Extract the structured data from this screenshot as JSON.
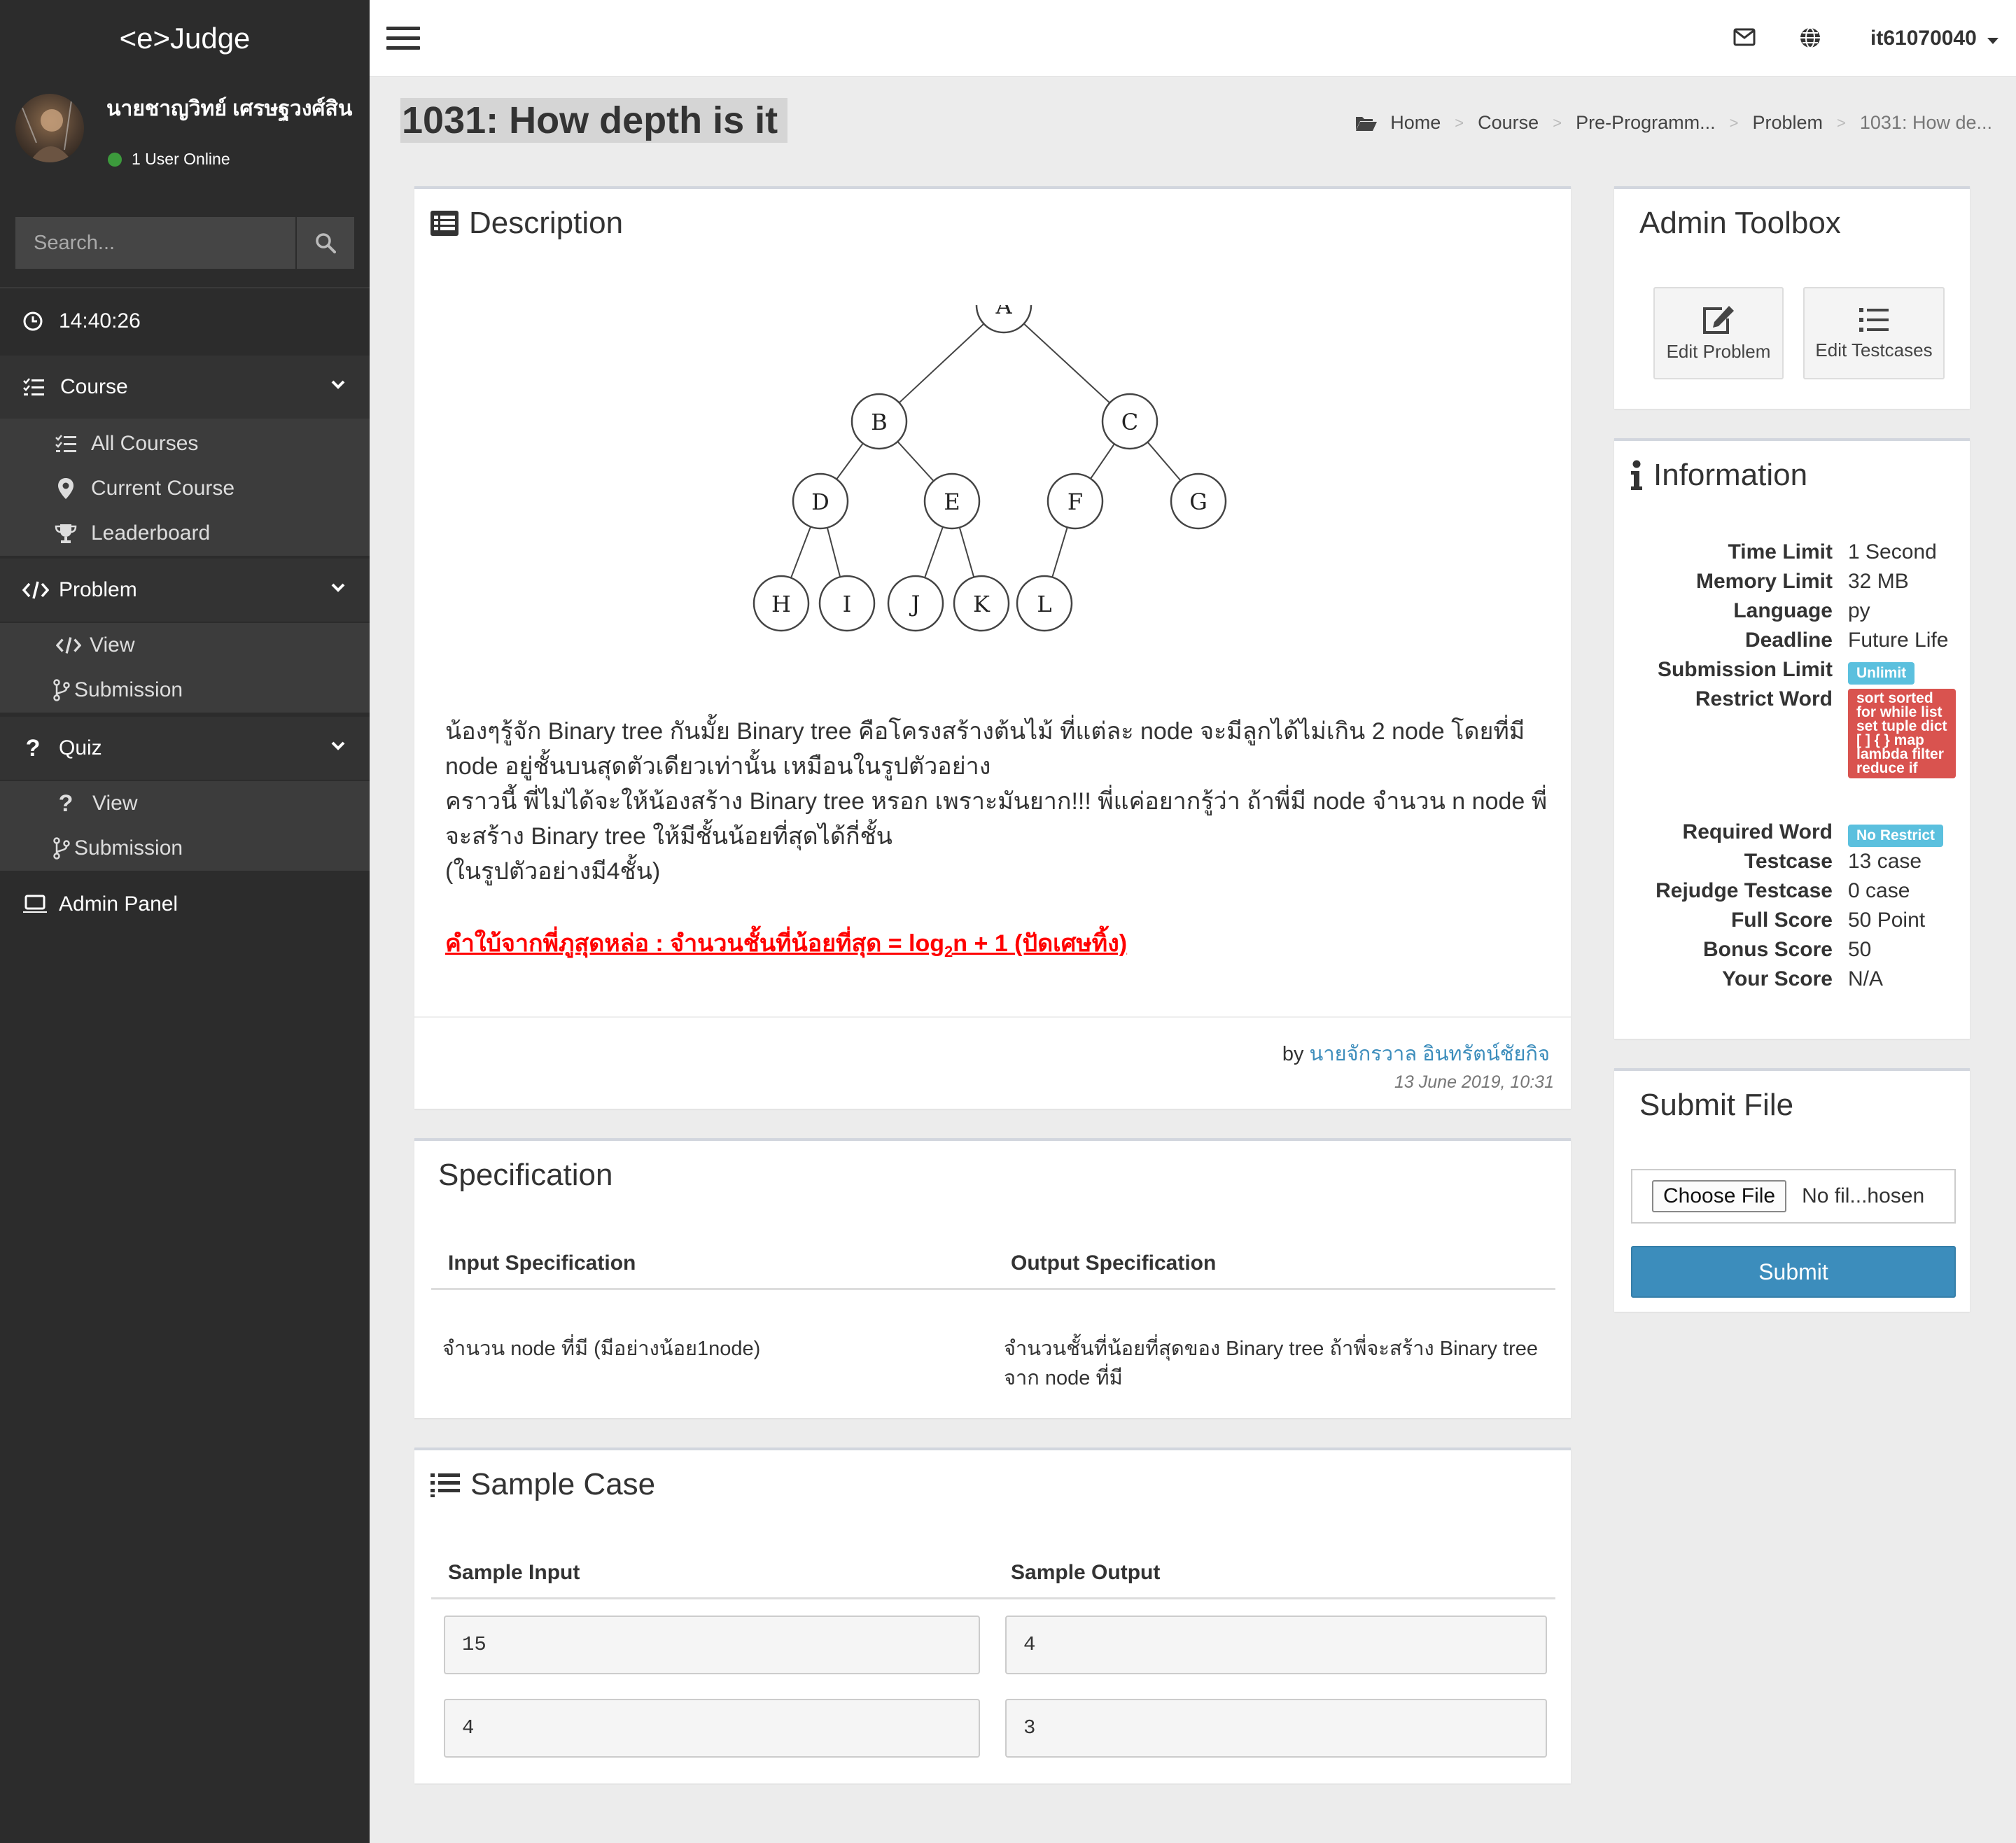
{
  "app": {
    "logo": "<e>Judge"
  },
  "user_panel": {
    "name": "นายชาญวิทย์ เศรษฐวงศ์สิน",
    "status": "1 User Online",
    "status_color": "#3c9a3c"
  },
  "sidebar": {
    "search_placeholder": "Search...",
    "clock": "14:40:26",
    "course": {
      "label": "Course",
      "items": [
        {
          "label": "All Courses",
          "icon": "list-check-icon"
        },
        {
          "label": "Current Course",
          "icon": "map-pin-icon"
        },
        {
          "label": "Leaderboard",
          "icon": "trophy-icon"
        }
      ]
    },
    "problem": {
      "label": "Problem",
      "items": [
        {
          "label": "View",
          "icon": "code-icon"
        },
        {
          "label": "Submission",
          "icon": "branch-icon"
        }
      ]
    },
    "quiz": {
      "label": "Quiz",
      "items": [
        {
          "label": "View",
          "icon": "question-icon"
        },
        {
          "label": "Submission",
          "icon": "branch-icon"
        }
      ]
    },
    "admin_panel": "Admin Panel"
  },
  "topbar": {
    "username": "it61070040"
  },
  "page": {
    "title": "1031: How depth is it"
  },
  "breadcrumb": [
    "Home",
    "Course",
    "Pre-Programm...",
    "Problem",
    "1031: How de..."
  ],
  "description": {
    "heading": "Description",
    "tree_nodes": [
      "A",
      "B",
      "C",
      "D",
      "E",
      "F",
      "G",
      "H",
      "I",
      "J",
      "K",
      "L"
    ],
    "paragraph_1": "น้องๆรู้จัก Binary tree กันมั้ย Binary tree คือโครงสร้างต้นไม้ ที่แต่ละ node จะมีลูกได้ไม่เกิน 2 node โดยที่มี node อยู่ชั้นบนสุดตัวเดียวเท่านั้น เหมือนในรูปตัวอย่าง",
    "paragraph_2": "คราวนี้ พี่ไม่ได้จะให้น้องสร้าง Binary tree หรอก เพราะมันยาก!!! พี่แค่อยากรู้ว่า ถ้าพี่มี node จำนวน n node พี่จะสร้าง Binary tree ให้มีชั้นน้อยที่สุดได้กี่ชั้น",
    "paragraph_3": "(ในรูปตัวอย่างมี4ชั้น)",
    "hint_prefix": "คำใบ้จากพี่ภูสุดหล่อ : จำนวนชั้นที่น้อยที่สุด = log",
    "hint_sub": "2",
    "hint_suffix": "n + 1 (ปัดเศษทิ้ง)",
    "by_label": "by",
    "author": "นายจักรวาล อินทรัตน์ชัยกิจ",
    "date": "13 June 2019, 10:31"
  },
  "specification": {
    "heading": "Specification",
    "input_header": "Input Specification",
    "output_header": "Output Specification",
    "input_text": "จำนวน node ที่มี (มีอย่างน้อย1node)",
    "output_text": "จำนวนชั้นที่น้อยที่สุดของ Binary tree ถ้าพี่จะสร้าง Binary tree จาก node ที่มี"
  },
  "sample_case": {
    "heading": "Sample Case",
    "input_header": "Sample Input",
    "output_header": "Sample Output",
    "rows": [
      {
        "input": "15",
        "output": "4"
      },
      {
        "input": "4",
        "output": "3"
      }
    ]
  },
  "admin_toolbox": {
    "heading": "Admin Toolbox",
    "edit_problem": "Edit Problem",
    "edit_testcases": "Edit Testcases"
  },
  "information": {
    "heading": "Information",
    "time_limit_key": "Time Limit",
    "time_limit": "1 Second",
    "memory_limit_key": "Memory Limit",
    "memory_limit": "32 MB",
    "language_key": "Language",
    "language": "py",
    "deadline_key": "Deadline",
    "deadline": "Future Life",
    "submission_limit_key": "Submission Limit",
    "submission_limit": "Unlimit",
    "restrict_word_key": "Restrict Word",
    "restrict_word": "sort sorted for while list set tuple dict [ ] { } map lambda filter reduce if",
    "required_word_key": "Required Word",
    "required_word": "No Restrict",
    "testcase_key": "Testcase",
    "testcase": "13 case",
    "rejudge_key": "Rejudge Testcase",
    "rejudge": "0 case",
    "full_score_key": "Full Score",
    "full_score": "50 Point",
    "bonus_score_key": "Bonus Score",
    "bonus_score": "50",
    "your_score_key": "Your Score",
    "your_score": "N/A"
  },
  "submit_file": {
    "heading": "Submit File",
    "choose_file": "Choose File",
    "file_status": "No fil...hosen",
    "submit": "Submit"
  },
  "colors": {
    "sidebar": "#2c2c2c",
    "primary": "#3c8dbc",
    "badge_info": "#5bc0de",
    "badge_danger": "#d9534f",
    "hint": "#ff0000"
  }
}
